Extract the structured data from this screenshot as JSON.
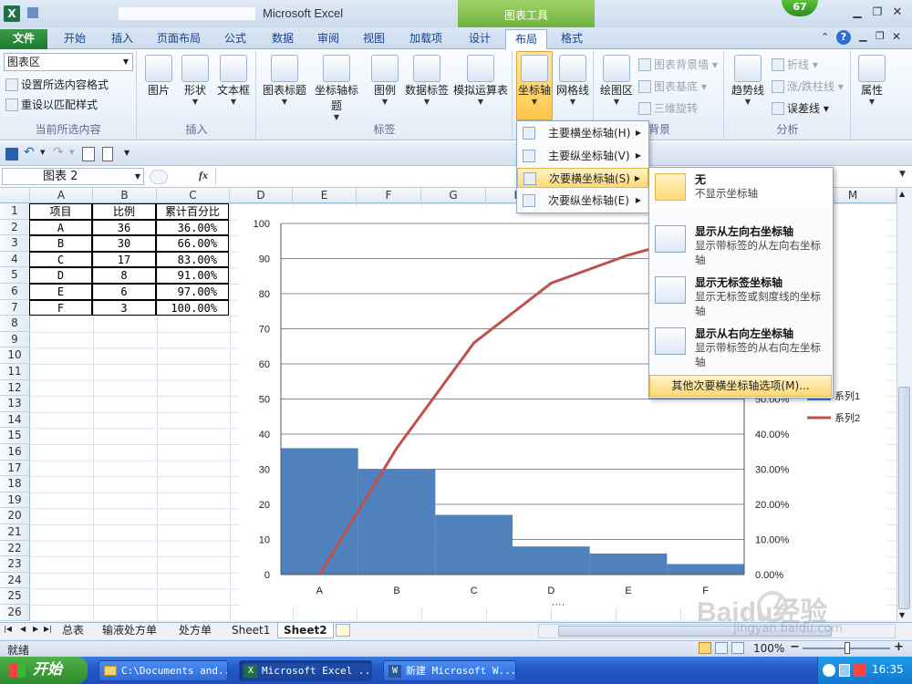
{
  "window": {
    "title": "Microsoft Excel",
    "context_tab_group": "图表工具",
    "badge": "67"
  },
  "ribbon_tabs": [
    "文件",
    "开始",
    "插入",
    "页面布局",
    "公式",
    "数据",
    "审阅",
    "视图",
    "加载项",
    "设计",
    "布局",
    "格式"
  ],
  "ribbon": {
    "current_selection": {
      "dropdown_value": "图表区",
      "format_selection": "设置所选内容格式",
      "reset_style": "重设以匹配样式",
      "label": "当前所选内容"
    },
    "insert": {
      "label": "插入",
      "items": [
        "图片",
        "形状",
        "文本框"
      ]
    },
    "labels": {
      "label": "标签",
      "items": [
        "图表标题",
        "坐标轴标题",
        "图例",
        "数据标签",
        "模拟运算表"
      ]
    },
    "axes": {
      "items": [
        "坐标轴",
        "网格线"
      ]
    },
    "background": {
      "label": "背景",
      "items": [
        "绘图区"
      ],
      "small_items": [
        "图表背景墙",
        "图表基底",
        "三维旋转"
      ]
    },
    "analysis": {
      "label": "分析",
      "items": [
        "趋势线"
      ],
      "small_items": [
        "折线",
        "涨/跌柱线",
        "误差线"
      ]
    },
    "properties": {
      "label": "属性"
    }
  },
  "name_box": "图表 2",
  "fx_label": "fx",
  "columns": [
    "A",
    "B",
    "C",
    "D",
    "E",
    "F",
    "G",
    "H",
    "I",
    "J",
    "K",
    "L",
    "M"
  ],
  "rows": [
    "1",
    "2",
    "3",
    "4",
    "5",
    "6",
    "7",
    "8",
    "9",
    "10",
    "11",
    "12",
    "13",
    "14",
    "15",
    "16",
    "17",
    "18",
    "19",
    "20",
    "21",
    "22",
    "23",
    "24",
    "25",
    "26"
  ],
  "table": {
    "headers": [
      "项目",
      "比例",
      "累计百分比"
    ],
    "rows": [
      [
        "A",
        "36",
        "36.00%"
      ],
      [
        "B",
        "30",
        "66.00%"
      ],
      [
        "C",
        "17",
        "83.00%"
      ],
      [
        "D",
        "8",
        "91.00%"
      ],
      [
        "E",
        "6",
        "97.00%"
      ],
      [
        "F",
        "3",
        "100.00%"
      ]
    ]
  },
  "axis_menu": {
    "items": [
      "主要横坐标轴(H)",
      "主要纵坐标轴(V)",
      "次要横坐标轴(S)",
      "次要纵坐标轴(E)"
    ],
    "highlighted": 2
  },
  "submenu": {
    "items": [
      {
        "title": "无",
        "desc": "不显示坐标轴"
      },
      {
        "title": "显示从左向右坐标轴",
        "desc": "显示带标签的从左向右坐标轴"
      },
      {
        "title": "显示无标签坐标轴",
        "desc": "显示无标签或刻度线的坐标轴"
      },
      {
        "title": "显示从右向左坐标轴",
        "desc": "显示带标签的从右向左坐标轴"
      }
    ],
    "more": "其他次要横坐标轴选项(M)..."
  },
  "chart_data": {
    "type": "bar",
    "categories": [
      "A",
      "B",
      "C",
      "D",
      "E",
      "F"
    ],
    "series": [
      {
        "name": "系列1",
        "type": "bar",
        "axis": "primary",
        "values": [
          36,
          30,
          17,
          8,
          6,
          3
        ]
      },
      {
        "name": "系列2",
        "type": "line",
        "axis": "secondary",
        "values": [
          0,
          36,
          66,
          83,
          91,
          97
        ]
      }
    ],
    "ylim": [
      0,
      100
    ],
    "y_ticks": [
      "0",
      "10",
      "20",
      "30",
      "40",
      "50",
      "60",
      "70",
      "80",
      "90",
      "100"
    ],
    "y2lim": [
      0,
      100
    ],
    "y2_ticks": [
      "0.00%",
      "10.00%",
      "20.00%",
      "30.00%",
      "40.00%",
      "50.00%"
    ],
    "grid": true,
    "legend": "right",
    "colors": {
      "bar": "#4f81bd",
      "line": "#c0504d"
    }
  },
  "sheet_tabs": [
    "总表",
    "输液处方单",
    "处方单",
    "Sheet1",
    "Sheet2"
  ],
  "active_sheet": "Sheet2",
  "status": {
    "ready": "就绪",
    "zoom": "100%"
  },
  "taskbar": {
    "start": "开始",
    "items": [
      "C:\\Documents and...",
      "Microsoft Excel ...",
      "新建 Microsoft W..."
    ],
    "clock": "16:35"
  },
  "watermark": {
    "brand": "Baidu经验",
    "url": "jingyan.baidu.com"
  }
}
